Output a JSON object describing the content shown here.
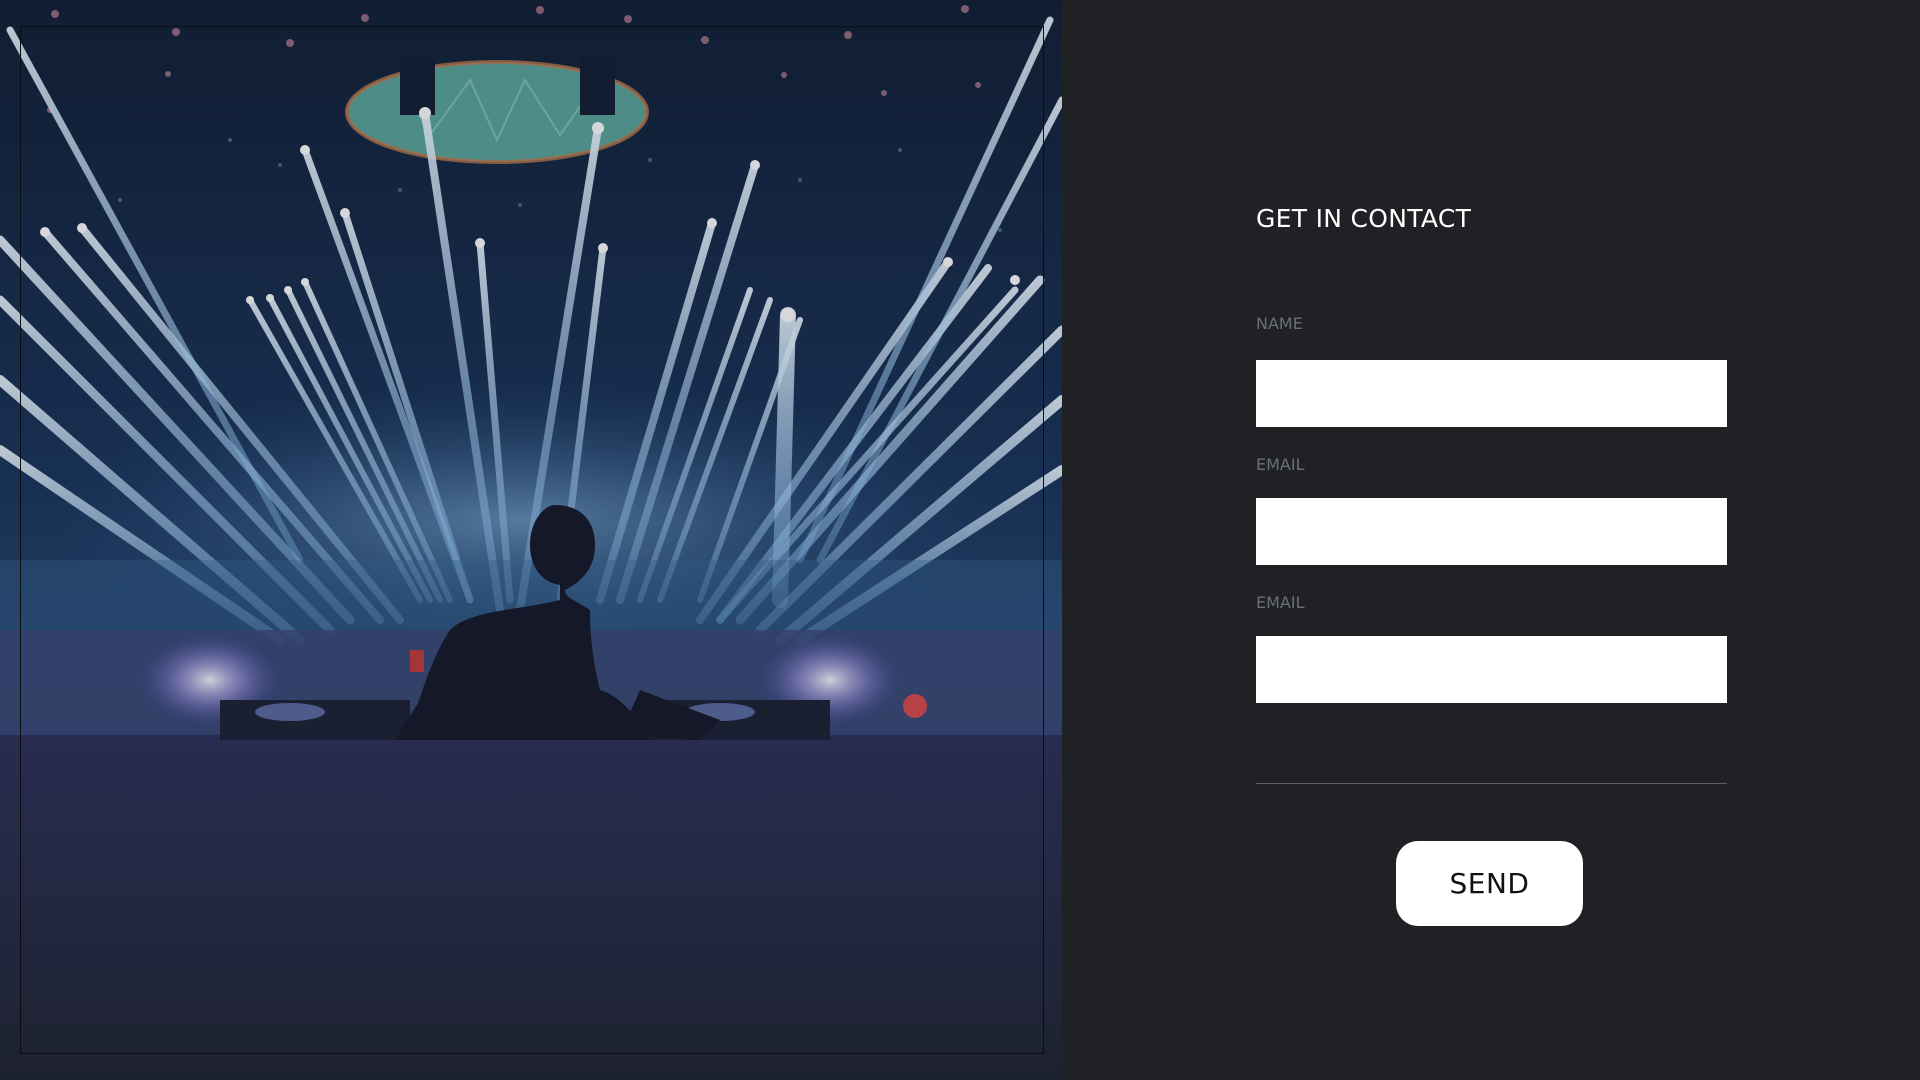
{
  "contact_form": {
    "title": "GET IN CONTACT",
    "fields": [
      {
        "label": "NAME",
        "value": "",
        "placeholder": ""
      },
      {
        "label": "EMAIL",
        "value": "",
        "placeholder": ""
      },
      {
        "label": "EMAIL",
        "value": "",
        "placeholder": ""
      }
    ],
    "send_label": "SEND"
  },
  "colors": {
    "page_background": "#1f2124",
    "input_background": "#ffffff",
    "label_text": "#6c7076",
    "title_text": "#ffffff",
    "button_background": "#ffffff"
  },
  "image": {
    "description_icon": "dj-concert-photo"
  }
}
